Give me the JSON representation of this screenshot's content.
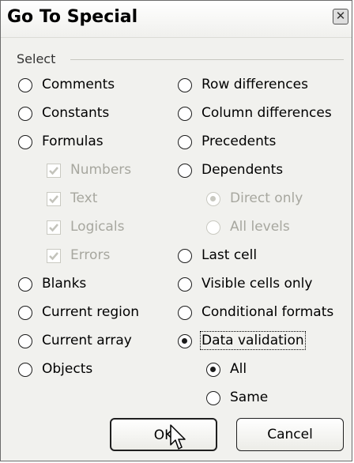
{
  "window": {
    "title": "Go To Special",
    "close_icon": "close-icon"
  },
  "group": {
    "label": "Select"
  },
  "left_options": [
    {
      "label": "Comments",
      "checked": false
    },
    {
      "label": "Constants",
      "checked": false
    },
    {
      "label": "Formulas",
      "checked": false
    },
    {
      "label": "Blanks",
      "checked": false
    },
    {
      "label": "Current region",
      "checked": false
    },
    {
      "label": "Current array",
      "checked": false
    },
    {
      "label": "Objects",
      "checked": false
    }
  ],
  "formula_types": [
    {
      "label": "Numbers",
      "checked": true,
      "disabled": true
    },
    {
      "label": "Text",
      "checked": true,
      "disabled": true
    },
    {
      "label": "Logicals",
      "checked": true,
      "disabled": true
    },
    {
      "label": "Errors",
      "checked": true,
      "disabled": true
    }
  ],
  "right_options": [
    {
      "label": "Row differences",
      "checked": false
    },
    {
      "label": "Column differences",
      "checked": false
    },
    {
      "label": "Precedents",
      "checked": false
    },
    {
      "label": "Dependents",
      "checked": false
    },
    {
      "label": "Last cell",
      "checked": false
    },
    {
      "label": "Visible cells only",
      "checked": false
    },
    {
      "label": "Conditional formats",
      "checked": false
    },
    {
      "label": "Data validation",
      "checked": true
    }
  ],
  "dependents_sub": [
    {
      "label": "Direct only",
      "checked": true,
      "disabled": true
    },
    {
      "label": "All levels",
      "checked": false,
      "disabled": true
    }
  ],
  "validation_sub": [
    {
      "label": "All",
      "checked": true
    },
    {
      "label": "Same",
      "checked": false
    }
  ],
  "buttons": {
    "ok": "OK",
    "cancel": "Cancel"
  }
}
